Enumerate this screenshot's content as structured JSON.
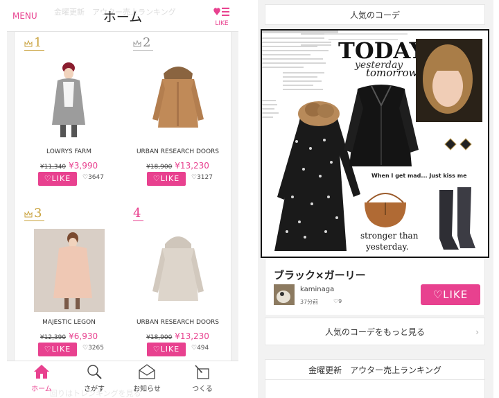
{
  "left": {
    "header": {
      "menu_label": "MENU",
      "ghost_text": "金曜更新　アウター売上ランキング",
      "title": "ホーム",
      "like_label": "LIKE"
    },
    "items": [
      {
        "rank": "1",
        "brand": "LOWRYS FARM",
        "old_price": "¥11,340",
        "price": "¥3,990",
        "like_label": "LIKE",
        "likes": "3647"
      },
      {
        "rank": "2",
        "brand": "URBAN RESEARCH DOORS",
        "old_price": "¥18,900",
        "price": "¥13,230",
        "like_label": "LIKE",
        "likes": "3127"
      },
      {
        "rank": "3",
        "brand": "MAJESTIC LEGON",
        "old_price": "¥12,390",
        "price": "¥6,930",
        "like_label": "LIKE",
        "likes": "3265"
      },
      {
        "rank": "4",
        "brand": "URBAN RESEARCH DOORS",
        "old_price": "¥18,900",
        "price": "¥13,230",
        "like_label": "LIKE",
        "likes": "494"
      }
    ],
    "tabs": [
      {
        "label": "ホーム",
        "icon": "home-icon"
      },
      {
        "label": "さがす",
        "icon": "search-icon"
      },
      {
        "label": "お知らせ",
        "icon": "mail-icon"
      },
      {
        "label": "つくる",
        "icon": "create-icon"
      }
    ],
    "ghost_footer": "回りはトレンキングを見る"
  },
  "right": {
    "popular_header": "人気のコーデ",
    "collage": {
      "today": "TODAY",
      "yesterday": "yesterday",
      "tomorrow": "tomorrow",
      "quote": "When I get mad... Just kiss me",
      "stronger": "stronger than",
      "yesterday_line": "yesterday."
    },
    "card": {
      "title": "ブラック×ガーリー",
      "username": "kaminaga",
      "time": "37分前",
      "likes": "9",
      "like_label": "LIKE"
    },
    "more_label": "人気のコーデをもっと見る",
    "ranking_header": "金曜更新　アウター売上ランキング"
  },
  "colors": {
    "accent": "#e8418f",
    "gold": "#c9a23c"
  }
}
